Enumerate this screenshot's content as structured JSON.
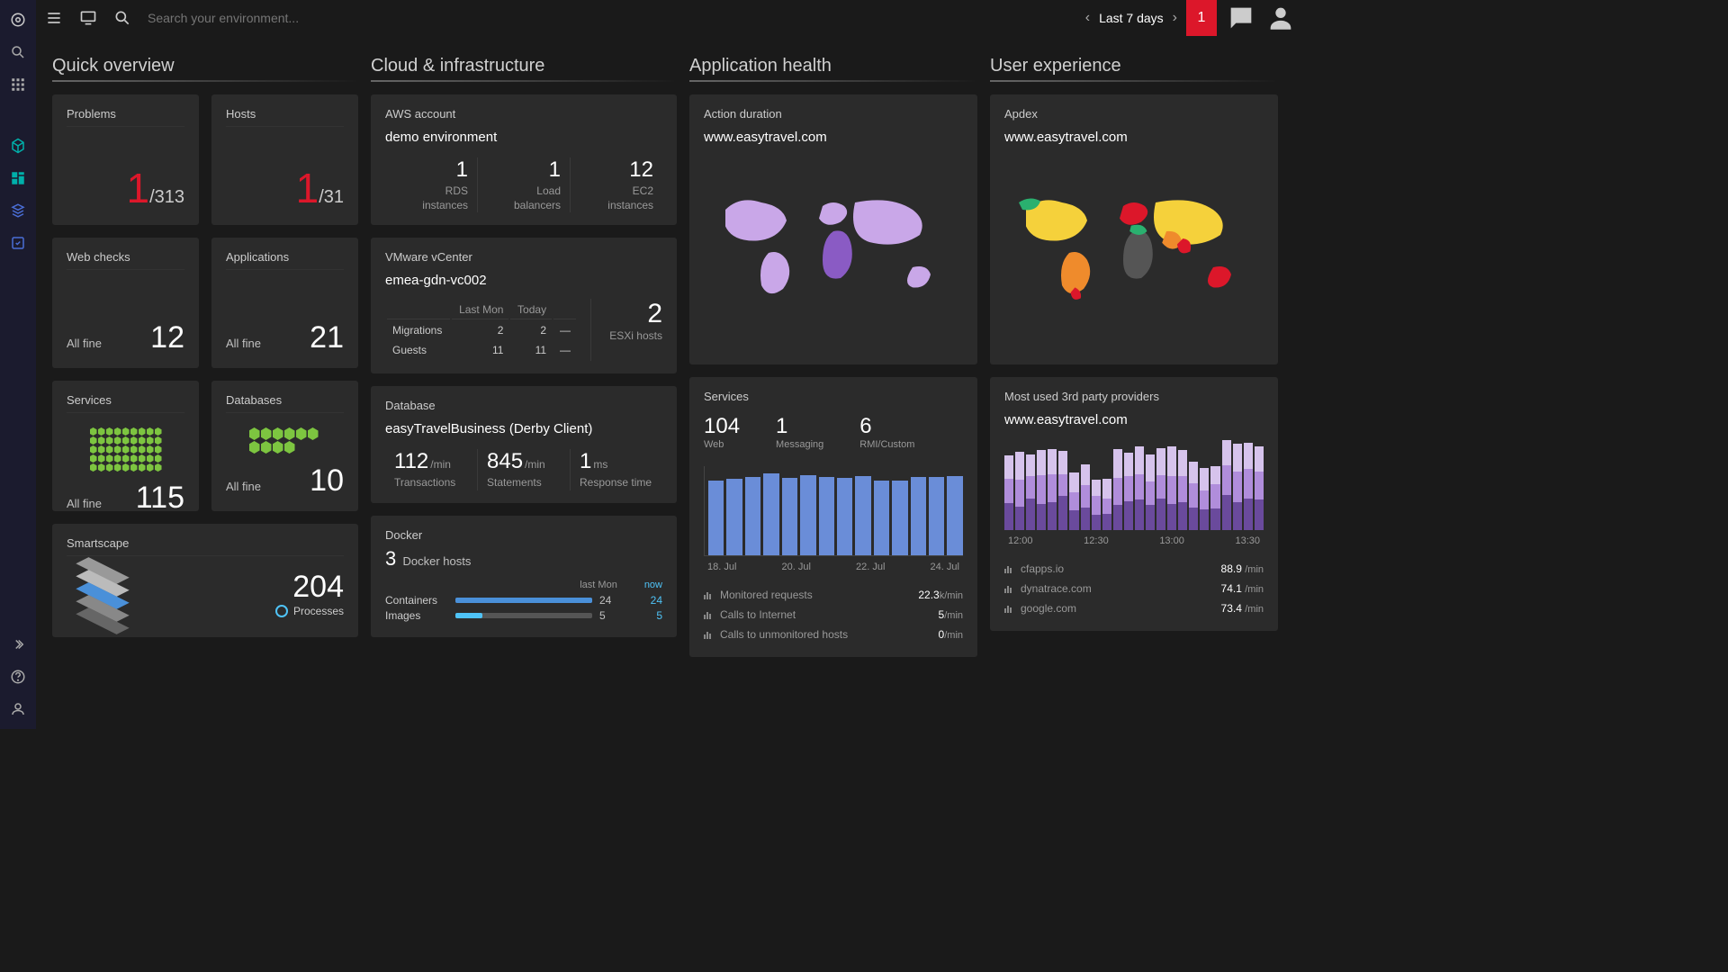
{
  "topbar": {
    "search_placeholder": "Search your environment...",
    "time_label": "Last 7 days",
    "alert_count": "1"
  },
  "sections": {
    "quick": "Quick overview",
    "cloud": "Cloud & infrastructure",
    "health": "Application health",
    "ux": "User experience"
  },
  "quick": {
    "problems": {
      "label": "Problems",
      "value": "1",
      "total": "/313"
    },
    "hosts": {
      "label": "Hosts",
      "value": "1",
      "total": "/31"
    },
    "webchecks": {
      "label": "Web checks",
      "status": "All fine",
      "value": "12"
    },
    "applications": {
      "label": "Applications",
      "status": "All fine",
      "value": "21"
    },
    "services": {
      "label": "Services",
      "status": "All fine",
      "value": "115"
    },
    "databases": {
      "label": "Databases",
      "status": "All fine",
      "value": "10"
    },
    "smartscape": {
      "label": "Smartscape",
      "value": "204",
      "sub": "Processes"
    }
  },
  "cloud": {
    "aws": {
      "label": "AWS account",
      "title": "demo environment",
      "rds": {
        "v": "1",
        "l1": "RDS",
        "l2": "instances"
      },
      "lb": {
        "v": "1",
        "l1": "Load",
        "l2": "balancers"
      },
      "ec2": {
        "v": "12",
        "l1": "EC2",
        "l2": "instances"
      }
    },
    "vmware": {
      "label": "VMware vCenter",
      "title": "emea-gdn-vc002",
      "col1": "Last Mon",
      "col2": "Today",
      "mig_label": "Migrations",
      "mig_lm": "2",
      "mig_td": "2",
      "gst_label": "Guests",
      "gst_lm": "11",
      "gst_td": "11",
      "esxi_v": "2",
      "esxi_l": "ESXi hosts"
    },
    "db": {
      "label": "Database",
      "title": "easyTravelBusiness (Derby Client)",
      "tx": {
        "v": "112",
        "u": "/min",
        "l": "Transactions"
      },
      "stm": {
        "v": "845",
        "u": "/min",
        "l": "Statements"
      },
      "rt": {
        "v": "1",
        "u": "ms",
        "l": "Response time"
      }
    },
    "docker": {
      "label": "Docker",
      "hosts_v": "3",
      "hosts_l": "Docker hosts",
      "head_lm": "last Mon",
      "head_now": "now",
      "containers": {
        "l": "Containers",
        "lm": "24",
        "now": "24"
      },
      "images": {
        "l": "Images",
        "lm": "5",
        "now": "5"
      }
    }
  },
  "health": {
    "action": {
      "label": "Action duration",
      "title": "www.easytravel.com"
    },
    "services": {
      "label": "Services",
      "web": {
        "v": "104",
        "l": "Web"
      },
      "msg": {
        "v": "1",
        "l": "Messaging"
      },
      "rmi": {
        "v": "6",
        "l": "RMI/Custom"
      },
      "xlabels": [
        "18. Jul",
        "20. Jul",
        "22. Jul",
        "24. Jul"
      ],
      "req_monitored": {
        "l": "Monitored requests",
        "v": "22.3",
        "u": "k/min"
      },
      "req_internet": {
        "l": "Calls to Internet",
        "v": "5",
        "u": "/min"
      },
      "req_unmon": {
        "l": "Calls to unmonitored hosts",
        "v": "0",
        "u": "/min"
      }
    }
  },
  "ux": {
    "apdex": {
      "label": "Apdex",
      "title": "www.easytravel.com"
    },
    "third": {
      "label": "Most used 3rd party providers",
      "title": "www.easytravel.com",
      "xlabels": [
        "12:00",
        "12:30",
        "13:00",
        "13:30"
      ],
      "p1": {
        "l": "cfapps.io",
        "v": "88.9",
        "u": "/min",
        "c": "#6a4a9c"
      },
      "p2": {
        "l": "dynatrace.com",
        "v": "74.1",
        "u": "/min",
        "c": "#b08ddb"
      },
      "p3": {
        "l": "google.com",
        "v": "73.4",
        "u": "/min",
        "c": "#d6c3ec"
      }
    }
  },
  "chart_data": [
    {
      "type": "bar",
      "id": "services-requests",
      "title": "Services",
      "x": [
        "18. Jul",
        "19. Jul",
        "20. Jul",
        "21. Jul",
        "22. Jul",
        "23. Jul",
        "24. Jul"
      ],
      "series": [
        {
          "name": "Monitored requests (k/min)",
          "values": [
            21,
            21.5,
            22,
            23,
            21.8,
            22.5,
            22,
            21.8,
            22.3,
            21,
            21,
            22,
            22,
            22.3
          ]
        }
      ],
      "ylim": [
        0,
        25
      ],
      "ylabel": "k/min"
    },
    {
      "type": "bar",
      "id": "third-party-stacked",
      "title": "Most used 3rd party providers",
      "x": [
        "12:00",
        "12:10",
        "12:20",
        "12:30",
        "12:40",
        "12:50",
        "13:00",
        "13:10",
        "13:20",
        "13:30",
        "13:40",
        "13:50"
      ],
      "series": [
        {
          "name": "cfapps.io",
          "values": [
            70,
            82,
            90,
            60,
            52,
            78,
            84,
            88,
            76,
            65,
            92,
            96
          ]
        },
        {
          "name": "dynatrace.com",
          "values": [
            70,
            74,
            72,
            60,
            50,
            74,
            76,
            78,
            72,
            62,
            80,
            84
          ]
        },
        {
          "name": "google.com",
          "values": [
            72,
            73,
            74,
            62,
            48,
            73,
            75,
            76,
            70,
            60,
            78,
            82
          ]
        }
      ],
      "ylabel": "/min",
      "ylim": [
        0,
        260
      ]
    },
    {
      "type": "map",
      "id": "action-duration-map",
      "title": "Action duration — www.easytravel.com",
      "metric": "action_duration",
      "legend": {
        "low": "#c9a7e8",
        "high": "#8a5bc4",
        "na": "#555"
      },
      "regions": {
        "North America": "low",
        "South America": "low",
        "Europe": "low",
        "Africa": "high",
        "Asia": "low",
        "Oceania": "low"
      }
    },
    {
      "type": "map",
      "id": "apdex-map",
      "title": "Apdex — www.easytravel.com",
      "metric": "apdex",
      "legend": {
        "excellent": "#2ab06f",
        "good": "#f5d13b",
        "fair": "#ef8b2c",
        "poor": "#dc172a",
        "na": "#555"
      },
      "regions": {
        "North America": "good",
        "USA": "good",
        "Canada": "excellent",
        "Mexico": "fair",
        "Brazil": "fair",
        "Argentina": "fair",
        "Chile": "poor",
        "Peru": "excellent",
        "Western Europe": "poor",
        "UK": "poor",
        "Germany": "good",
        "Spain": "good",
        "Russia": "good",
        "North Africa": "excellent",
        "Sub-Saharan Africa": "na",
        "South Africa": "excellent",
        "Middle East": "fair",
        "India": "poor",
        "China": "good",
        "SE Asia": "fair",
        "Australia": "poor",
        "New Zealand": "na"
      }
    }
  ]
}
